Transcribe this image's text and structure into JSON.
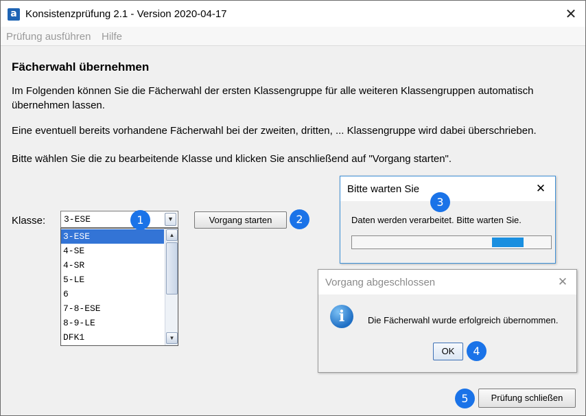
{
  "window": {
    "app_icon_letter": "a",
    "title": "Konsistenzprüfung 2.1 - Version 2020-04-17",
    "close_glyph": "✕"
  },
  "menu": {
    "items": [
      {
        "label": "Prüfung ausführen"
      },
      {
        "label": "Hilfe"
      }
    ]
  },
  "main": {
    "heading": "Fächerwahl übernehmen",
    "para1": "Im Folgenden können Sie die Fächerwahl der ersten Klassengruppe für alle weiteren Klassengruppen automatisch übernehmen lassen.",
    "para2": "Eine eventuell bereits vorhandene Fächerwahl bei der zweiten, dritten, ... Klassengruppe wird dabei überschrieben.",
    "para3": "Bitte wählen Sie die zu bearbeitende Klasse und klicken Sie anschließend auf \"Vorgang starten\".",
    "klasse_label": "Klasse:",
    "combo_value": "3-ESE",
    "dropdown_items": [
      "3-ESE",
      "4-SE",
      "4-SR",
      "5-LE",
      "6",
      "7-8-ESE",
      "8-9-LE",
      "DFK1"
    ],
    "selected_index": 0,
    "start_button": "Vorgang starten",
    "close_button": "Prüfung schließen"
  },
  "badges": [
    "1",
    "2",
    "3",
    "4",
    "5"
  ],
  "wait_dialog": {
    "title": "Bitte warten Sie",
    "message": "Daten werden verarbeitet. Bitte warten Sie.",
    "progress_indeterminate": true
  },
  "done_dialog": {
    "title": "Vorgang abgeschlossen",
    "message": "Die Fächerwahl wurde erfolgreich übernommen.",
    "ok_button": "OK",
    "icon_letter": "i"
  },
  "colors": {
    "badge": "#1a73e8",
    "selection": "#3374d6",
    "progress": "#1a8fe0"
  },
  "icons": {
    "app": "app-logo-icon",
    "close": "close-icon",
    "dropdown": "chevron-down-icon",
    "scroll_up": "scroll-up-icon",
    "scroll_down": "scroll-down-icon",
    "info": "info-icon"
  }
}
